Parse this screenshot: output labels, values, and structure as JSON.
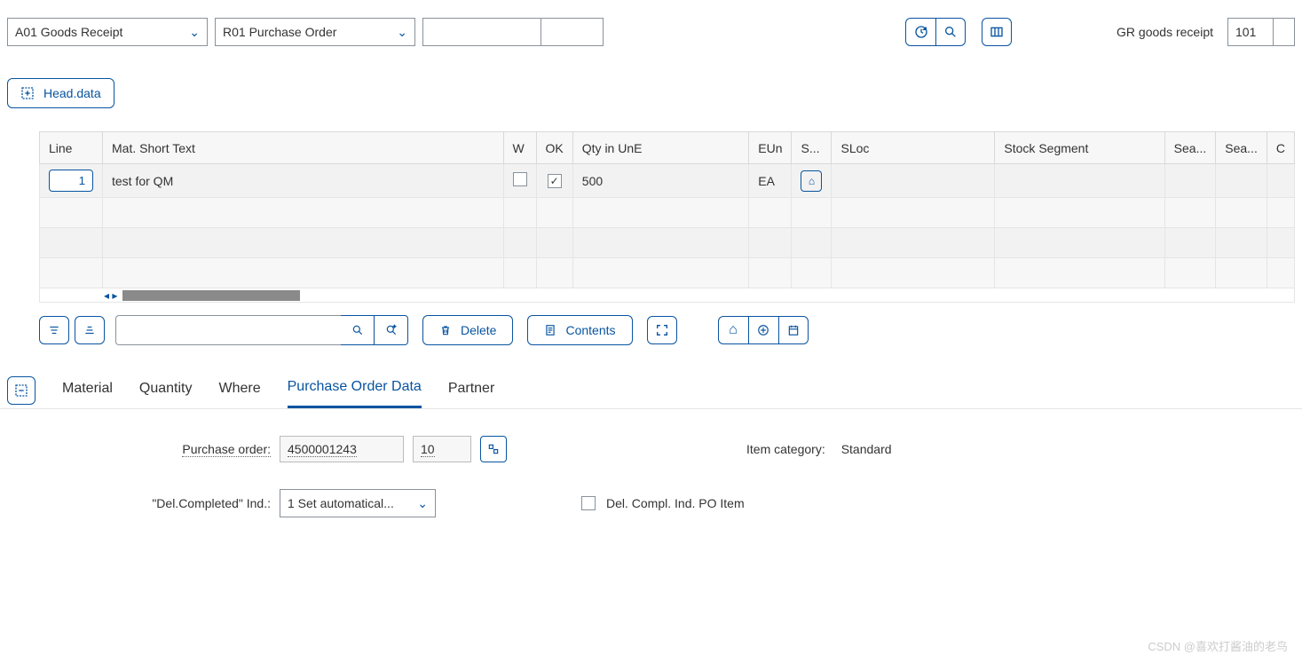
{
  "top": {
    "transaction_dropdown": "A01 Goods Receipt",
    "ref_dropdown": "R01 Purchase Order",
    "gr_label": "GR goods receipt",
    "movement_type": "101"
  },
  "head_data_btn": "Head.data",
  "grid": {
    "headers": [
      "Line",
      "Mat. Short Text",
      "W",
      "OK",
      "Qty in UnE",
      "EUn",
      "S...",
      "SLoc",
      "Stock Segment",
      "Sea...",
      "Sea...",
      "C"
    ],
    "rows": [
      {
        "line": "1",
        "mat_text": "test for QM",
        "w": false,
        "ok": true,
        "qty": "500",
        "eun": "EA",
        "s": "home",
        "sloc": "",
        "stock_seg": ""
      }
    ]
  },
  "toolbar": {
    "delete": "Delete",
    "contents": "Contents"
  },
  "tabs": {
    "material": "Material",
    "quantity": "Quantity",
    "where": "Where",
    "po_data": "Purchase Order Data",
    "partner": "Partner"
  },
  "detail": {
    "po_label": "Purchase order:",
    "po_number": "4500001243",
    "po_item": "10",
    "item_category_label": "Item category:",
    "item_category_value": "Standard",
    "del_compl_label": "\"Del.Completed\" Ind.:",
    "del_compl_value": "1 Set automatical...",
    "del_compl_po_item": "Del. Compl. Ind. PO Item"
  },
  "watermark": "CSDN @喜欢打酱油的老鸟"
}
